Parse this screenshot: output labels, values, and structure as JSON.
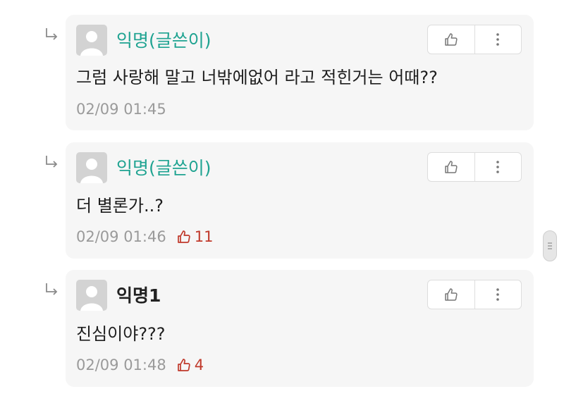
{
  "comments": [
    {
      "author": "익명(글쓴이)",
      "text": "그럼 사랑해 말고 너밖에없어 라고 적힌거는 어때??",
      "time": "02/09 01:45",
      "likes": ""
    },
    {
      "author": "익명(글쓴이)",
      "text": "더 별론가..?",
      "time": "02/09 01:46",
      "likes": "11"
    },
    {
      "author": "익명1",
      "text": "진심이야???",
      "time": "02/09 01:48",
      "likes": "4"
    }
  ],
  "colors": {
    "writer": "#1fa391",
    "likes": "#c0392b",
    "meta": "#9a9a9a",
    "card": "#f6f6f6"
  },
  "icons": {
    "reply": "reply-arrow-icon",
    "like": "thumbs-up-icon",
    "more": "more-vertical-icon",
    "avatar": "default-avatar-icon"
  }
}
